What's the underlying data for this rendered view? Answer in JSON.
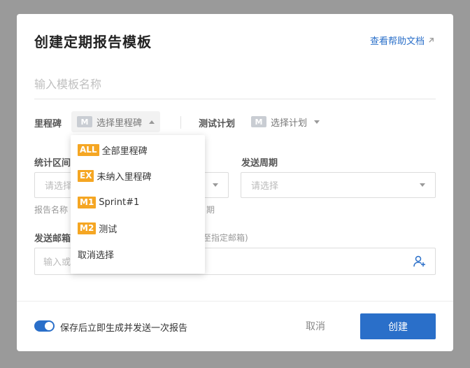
{
  "dialog": {
    "title": "创建定期报告模板",
    "help_link": "查看帮助文档",
    "name_placeholder": "输入模板名称"
  },
  "milestone": {
    "label": "里程碑",
    "badge": "M",
    "placeholder": "选择里程碑"
  },
  "test_plan": {
    "label": "测试计划",
    "badge": "M",
    "placeholder": "选择计划"
  },
  "stat_range": {
    "label": "统计区间",
    "placeholder": "请选择"
  },
  "send_cycle": {
    "label": "发送周期",
    "placeholder": "请选择"
  },
  "hints": {
    "left": "报告名称",
    "right": "期"
  },
  "email": {
    "label": "发送邮箱",
    "note": "至指定邮箱)",
    "placeholder": "输入或"
  },
  "dropdown": {
    "items": [
      {
        "tag": "ALL",
        "label": "全部里程碑"
      },
      {
        "tag": "EX",
        "label": "未纳入里程碑"
      },
      {
        "tag": "M1",
        "label": "Sprint#1"
      },
      {
        "tag": "M2",
        "label": "测试"
      },
      {
        "tag": "",
        "label": "取消选择"
      }
    ]
  },
  "footer": {
    "toggle_label": "保存后立即生成并发送一次报告",
    "toggle_on": true,
    "cancel_label": "取消",
    "create_label": "创建"
  },
  "colors": {
    "accent": "#2a6fc9",
    "tag": "#f5a623"
  }
}
